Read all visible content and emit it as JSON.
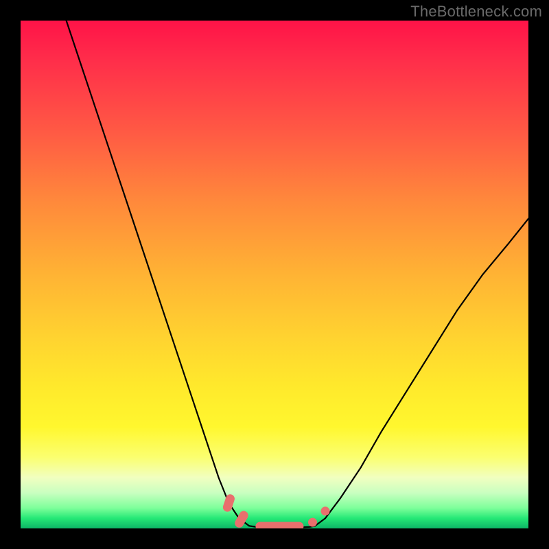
{
  "attribution": "TheBottleneck.com",
  "chart_data": {
    "type": "line",
    "title": "",
    "xlabel": "",
    "ylabel": "",
    "xlim": [
      0,
      100
    ],
    "ylim": [
      0,
      100
    ],
    "grid": false,
    "legend": false,
    "series": [
      {
        "name": "left-branch",
        "x": [
          9,
          12,
          15,
          18,
          21,
          24,
          27,
          30,
          33,
          36,
          39,
          41,
          43,
          45
        ],
        "y": [
          100,
          91,
          82,
          73,
          64,
          55,
          46,
          37,
          28,
          19,
          10,
          5,
          2,
          0.5
        ]
      },
      {
        "name": "right-branch",
        "x": [
          58,
          60,
          63,
          67,
          71,
          76,
          81,
          86,
          91,
          96,
          100
        ],
        "y": [
          0.5,
          2,
          6,
          12,
          19,
          27,
          35,
          43,
          50,
          56,
          61
        ]
      },
      {
        "name": "valley-floor",
        "x": [
          45,
          47,
          49,
          51,
          53,
          55,
          57,
          58
        ],
        "y": [
          0.5,
          0.2,
          0.1,
          0.1,
          0.1,
          0.2,
          0.3,
          0.5
        ]
      }
    ],
    "markers": [
      {
        "name": "pill-left-upper",
        "x": 41.0,
        "y": 5.0,
        "shape": "pill",
        "angle": -72
      },
      {
        "name": "pill-left-lower",
        "x": 43.5,
        "y": 1.8,
        "shape": "pill",
        "angle": -60
      },
      {
        "name": "pill-floor",
        "x": 51.0,
        "y": 0.4,
        "shape": "pill-long",
        "angle": 0
      },
      {
        "name": "pill-right-lower",
        "x": 57.5,
        "y": 1.2,
        "shape": "dot",
        "angle": 0
      },
      {
        "name": "pill-right-upper",
        "x": 60.0,
        "y": 3.4,
        "shape": "dot",
        "angle": 0
      }
    ],
    "colors": {
      "curve": "#000000",
      "marker": "#e96f6d",
      "gradient_top": "#ff1348",
      "gradient_bottom": "#0db566"
    }
  }
}
